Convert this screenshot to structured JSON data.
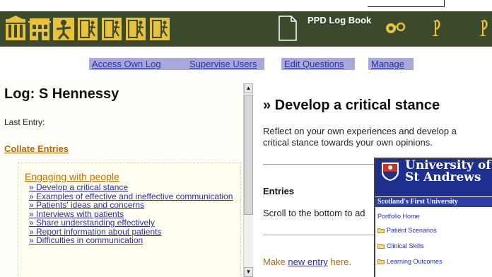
{
  "toolbar": {
    "app_title": "PPD Log Book",
    "icons": [
      "home-icon",
      "building-icon",
      "person-star-icon",
      "escape-door-icon",
      "escape-door-icon",
      "escape-door-icon",
      "escape-door-icon",
      "document-icon",
      "glasses-icon",
      "trumpet-icon",
      "trumpet-icon"
    ],
    "bg_color": "#3a4a2a",
    "icon_color": "#e8c23a"
  },
  "nav": {
    "links": [
      "Access Own Log",
      "Supervise Users",
      "Edit Questions",
      "Manage"
    ]
  },
  "log": {
    "title": "Log: S Hennessy",
    "last_entry_label": "Last Entry:",
    "collate_label": "Collate Entries",
    "section_heading": "Engaging with people",
    "items": [
      "» Develop a critical stance",
      "» Examples of effective and ineffective communication",
      "» Patients' ideas and concerns",
      "» Interviews with patients",
      "» Share understanding effectively",
      "» Report information about patients",
      "» Difficulties in communication"
    ]
  },
  "detail": {
    "title": "» Develop a critical stance",
    "description": "Reflect on your own experiences and develop a critical stance towards your own opinions.",
    "entries_label": "Entries",
    "scroll_text": "Scroll to the bottom to ad",
    "make_prefix": "Make ",
    "make_link": "new entry",
    "make_suffix": " here."
  },
  "popup": {
    "uni_line1": "University of",
    "uni_line2": "St Andrews",
    "tagline": "Scotland's First University",
    "home": "Portfolio Home",
    "menu": [
      "Patient Scenarios",
      "Clinical Skills",
      "Learning Outcomes"
    ]
  }
}
